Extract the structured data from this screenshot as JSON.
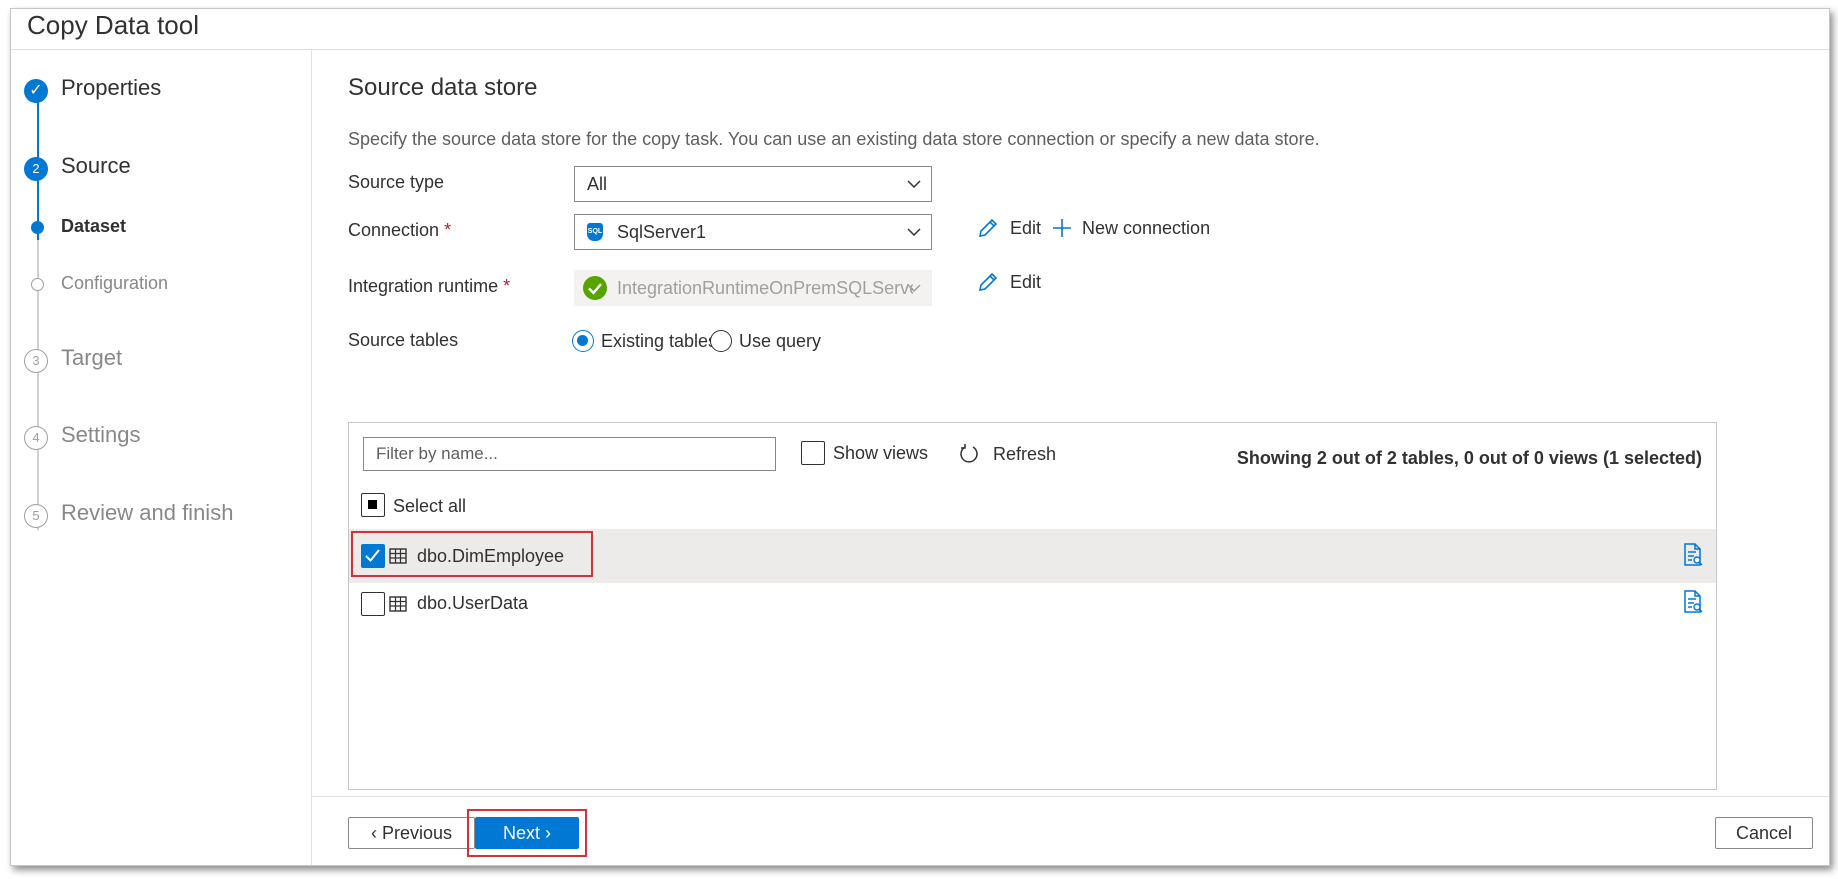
{
  "window": {
    "title": "Copy Data tool"
  },
  "steps": {
    "items": [
      {
        "marker": "✓",
        "label": "Properties"
      },
      {
        "marker": "2",
        "label": "Source"
      },
      {
        "label": "Dataset"
      },
      {
        "label": "Configuration"
      },
      {
        "marker": "3",
        "label": "Target"
      },
      {
        "marker": "4",
        "label": "Settings"
      },
      {
        "marker": "5",
        "label": "Review and finish"
      }
    ]
  },
  "main": {
    "heading": "Source data store",
    "description": "Specify the source data store for the copy task. You can use an existing data store connection or specify a new data store.",
    "source_type": {
      "label": "Source type",
      "value": "All"
    },
    "connection": {
      "label": "Connection",
      "required_mark": "*",
      "value": "SqlServer1",
      "icon_text": "SQL",
      "edit_label": "Edit",
      "new_connection_label": "New connection"
    },
    "integration_runtime": {
      "label": "Integration runtime",
      "required_mark": "*",
      "value": "IntegrationRuntimeOnPremSQLServer",
      "edit_label": "Edit"
    },
    "source_tables": {
      "label": "Source tables",
      "options": [
        "Existing tables",
        "Use query"
      ],
      "selected": "Existing tables"
    },
    "table_panel": {
      "filter_placeholder": "Filter by name...",
      "show_views_label": "Show views",
      "refresh_label": "Refresh",
      "summary": "Showing 2 out of 2 tables, 0 out of 0 views (1 selected)",
      "select_all_label": "Select all",
      "rows": [
        {
          "name": "dbo.DimEmployee",
          "checked": true
        },
        {
          "name": "dbo.UserData",
          "checked": false
        }
      ]
    }
  },
  "footer": {
    "previous_label": "Previous",
    "next_label": "Next",
    "cancel_label": "Cancel"
  },
  "colors": {
    "accent": "#0078d4",
    "success": "#57a300",
    "highlight_frame": "#d13438",
    "required": "#a4262c"
  }
}
